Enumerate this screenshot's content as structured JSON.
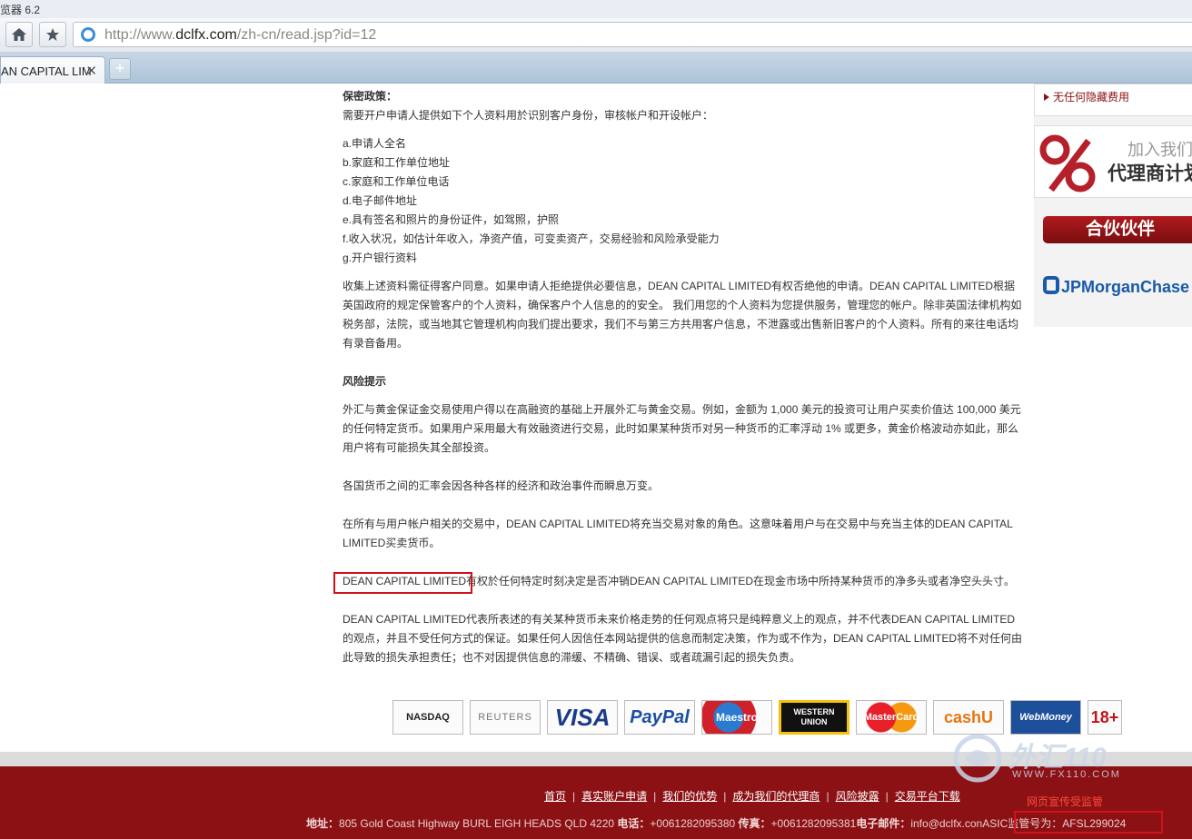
{
  "browser": {
    "title_fragment": "览器 6.2",
    "url_prefix": "http://www.",
    "url_domain": "dclfx.com",
    "url_path": "/zh-cn/read.jsp?id=12",
    "tab_label": "AN CAPITAL LIM",
    "tab_close": "✕",
    "new_tab": "+"
  },
  "article": {
    "privacy_heading": "保密政策：",
    "privacy_intro": "需要开户申请人提供如下个人资料用於识别客户身份，审核帐户和开设帐户：",
    "items": [
      "a.申请人全名",
      "b.家庭和工作单位地址",
      "c.家庭和工作单位电话",
      "d.电子邮件地址",
      "e.具有签名和照片的身份证件，如驾照，护照",
      "f.收入状况，如估计年收入，净资产值，可变卖资产，交易经验和风险承受能力",
      "g.开户银行资料"
    ],
    "collect_para": "收集上述资料需征得客户同意。如果申请人拒绝提供必要信息，DEAN CAPITAL LIMITED有权否绝他的申请。DEAN CAPITAL LIMITED根据英国政府的规定保管客户的个人资料，确保客户个人信息的的安全。 我们用您的个人资料为您提供服务，管理您的帐户。除非英国法律机构如税务部，法院，或当地其它管理机构向我们提出要求，我们不与第三方共用客户信息，不泄露或出售新旧客户的个人资料。所有的来往电话均有录音备用。",
    "risk_heading": "风险提示",
    "risk_para1": "外汇与黄金保证金交易使用户得以在高融资的基础上开展外汇与黄金交易。例如，金额为 1,000 美元的投资可让用户买卖价值达 100,000 美元的任何特定货币。如果用户采用最大有效融资进行交易，此时如果某种货币对另一种货币的汇率浮动 1% 或更多，黄金价格波动亦如此，那么用户将有可能损失其全部投资。",
    "risk_para2": "各国货币之间的汇率会因各种各样的经济和政治事件而瞬息万变。",
    "risk_para3": "在所有与用户帐户相关的交易中，DEAN CAPITAL LIMITED将充当交易对象的角色。这意味着用户与在交易中与充当主体的DEAN CAPITAL LIMITED买卖货币。",
    "risk_para4_name": "DEAN CAPITAL LIMITED",
    "risk_para4_rest": "有权於任何特定时刻决定是否冲销DEAN CAPITAL LIMITED在现金市场中所持某种货币的净多头或者净空头头寸。",
    "risk_para5": "DEAN CAPITAL LIMITED代表所表述的有关某种货币未来价格走势的任何观点将只是纯粹意义上的观点，并不代表DEAN CAPITAL LIMITED的观点，并且不受任何方式的保证。如果任何人因信任本网站提供的信息而制定决策，作为或不作为，DEAN CAPITAL LIMITED将不对任何由此导致的损失承担责任；也不对因提供信息的滞缓、不精确、错误、或者疏漏引起的损失负责。"
  },
  "sidebar": {
    "no_hidden_fees": "无任何隐藏费用",
    "join_us": "加入我们",
    "agent_plan": "代理商计划",
    "partners": "合伙伙伴",
    "partner_logo": "JPMorganChase"
  },
  "payments": [
    "NASDAQ",
    "REUTERS",
    "VISA",
    "PayPal",
    "Maestro",
    "WESTERN UNION",
    "MasterCard",
    "cashU",
    "WebMoney",
    "18+"
  ],
  "footer": {
    "links": [
      "首页",
      "真实账户申请",
      "我们的优势",
      "成为我们的代理商",
      "风险披露",
      "交易平台下载"
    ],
    "address_label": "地址：",
    "address": "805 Gold Coast Highway BURL EIGH HEADS QLD 4220",
    "phone_label": "电话：",
    "phone": "+0061282095380",
    "fax_label": "传真：",
    "fax": "+0061282095381",
    "email_label": "电子邮件：",
    "email": "info@dclfx.con",
    "asic": "ASIC监管号为：AFSL299024"
  },
  "watermark": {
    "brand": "外汇110",
    "site": "WWW.FX110.COM",
    "notice": "网页宣传受监管"
  }
}
